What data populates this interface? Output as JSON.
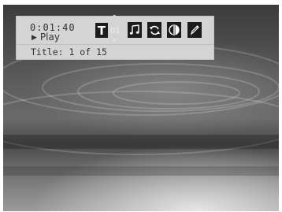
{
  "player": {
    "time": "0:01:40",
    "status": "Play",
    "title_spin_value": "01",
    "title_info": "Title: 1 of 15"
  },
  "icons": {
    "title": "T",
    "up": "⌃",
    "down": "⌄"
  }
}
